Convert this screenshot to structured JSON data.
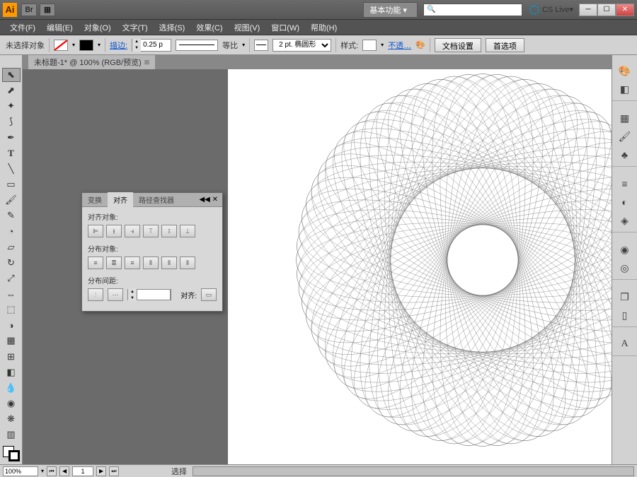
{
  "title": {
    "app": "Ai",
    "workspace": "基本功能",
    "cslive": "CS Live"
  },
  "menu": [
    "文件(F)",
    "编辑(E)",
    "对象(O)",
    "文字(T)",
    "选择(S)",
    "效果(C)",
    "视图(V)",
    "窗口(W)",
    "帮助(H)"
  ],
  "ctrl": {
    "selection": "未选择对象",
    "stroke_label": "描边:",
    "stroke_weight": "0.25 p",
    "uniform": "等比",
    "profile": "2 pt. 椭圆形",
    "style_label": "样式:",
    "opacity": "不透…",
    "doc_setup": "文档设置",
    "prefs": "首选项"
  },
  "doc_tab": {
    "name": "未标题-1* @ 100% (RGB/预览)"
  },
  "align_panel": {
    "tabs": [
      "变换",
      "对齐",
      "路径查找器"
    ],
    "sec1": "对齐对象:",
    "sec2": "分布对象:",
    "sec3": "分布间距:",
    "align_to": "对齐:"
  },
  "status": {
    "zoom": "100%",
    "page": "1",
    "tool": "选择"
  }
}
